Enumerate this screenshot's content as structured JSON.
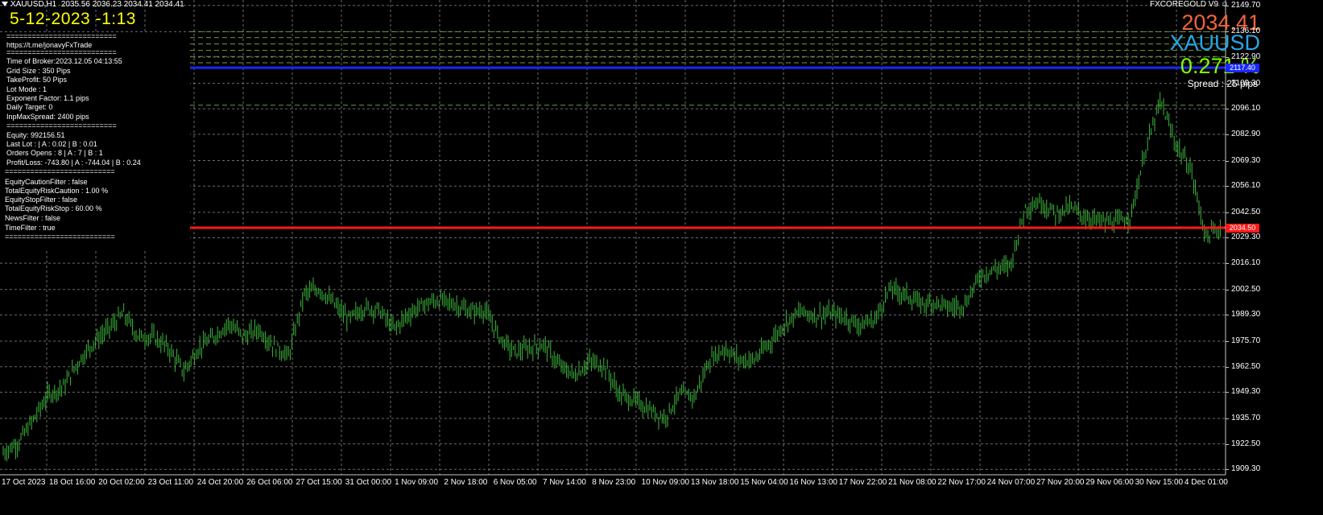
{
  "header": {
    "symbol_tf": "XAUUSD,H1",
    "ohlc": "2035.56 2036.23 2034.41 2034.41"
  },
  "broker_time": "5-12-2023 -1:13",
  "ea_name": "FXCOREGOLD V9 ☺",
  "overlay": {
    "price": "2034.41",
    "symbol": "XAUUSD",
    "percent": "0.271 %",
    "spread": "Spread : 25 pips"
  },
  "panel": {
    "lines": [
      "==========================",
      "https://t.me/jonavyFxTrade",
      "==========================",
      "Time of Broker:2023.12.05 04:13:55",
      "Grid Size : 350 Pips",
      "TakeProfit: 50 Pips",
      "Lot Mode : 1",
      "Exponent Factor: 1.1 pips",
      "Daily Target: 0",
      "InpMaxSpread: 2400 pips",
      "==========================",
      "Equity:     992156.51",
      "Last Lot : | A : 0.02 | B : 0.01",
      "Orders Opens :   8 | A : 7 | B : 1",
      "Profit/Loss: -743.80 | A : -744.04 | B : 0.24",
      "==========================",
      "EquityCautionFilter : false",
      "TotalEquityRiskCaution : 1.00 %",
      "EquityStopFilter : false",
      "TotalEquityRiskStop : 60.00 %",
      "NewsFilter : false",
      "TimeFilter : true",
      "=========================="
    ]
  },
  "price_tags": {
    "blue": "2117.40",
    "red": "2034.50"
  },
  "colors": {
    "bg": "#000000",
    "grid": "#6b6b6b",
    "bars": "#3db83d",
    "red_line": "#ff1a1a",
    "blue_line": "#1a28ff",
    "grid_levels": "#6a9e3c"
  },
  "chart_data": {
    "type": "line",
    "title": "XAUUSD,H1",
    "y_ticks": [
      "2149.70",
      "2136.10",
      "2122.90",
      "2109.30",
      "2096.10",
      "2082.90",
      "2069.30",
      "2056.10",
      "2042.50",
      "2029.30",
      "2016.10",
      "2002.50",
      "1989.30",
      "1975.70",
      "1962.50",
      "1949.30",
      "1935.70",
      "1922.50",
      "1909.30"
    ],
    "x_ticks": [
      "17 Oct 2023",
      "18 Oct 16:00",
      "20 Oct 02:00",
      "23 Oct 11:00",
      "24 Oct 20:00",
      "26 Oct 06:00",
      "27 Oct 15:00",
      "31 Oct 00:00",
      "1 Nov 09:00",
      "2 Nov 18:00",
      "6 Nov 05:00",
      "7 Nov 14:00",
      "8 Nov 23:00",
      "10 Nov 09:00",
      "13 Nov 18:00",
      "15 Nov 04:00",
      "16 Nov 13:00",
      "17 Nov 22:00",
      "21 Nov 08:00",
      "22 Nov 17:00",
      "24 Nov 07:00",
      "27 Nov 20:00",
      "29 Nov 06:00",
      "30 Nov 15:00",
      "4 Dec 01:00"
    ],
    "ylim": [
      1906.5,
      2152.5
    ],
    "price_path": [
      [
        0,
        1918
      ],
      [
        1,
        1923
      ],
      [
        2,
        1935
      ],
      [
        3,
        1948
      ],
      [
        4,
        1952
      ],
      [
        5,
        1965
      ],
      [
        6,
        1975
      ],
      [
        7,
        1982
      ],
      [
        8,
        1990
      ],
      [
        9,
        1978
      ],
      [
        10,
        1978
      ],
      [
        11,
        1972
      ],
      [
        12,
        1960
      ],
      [
        13,
        1972
      ],
      [
        14,
        1978
      ],
      [
        15,
        1985
      ],
      [
        16,
        1978
      ],
      [
        17,
        1982
      ],
      [
        18,
        1973
      ],
      [
        19,
        1968
      ],
      [
        20,
        2000
      ],
      [
        21,
        2003
      ],
      [
        22,
        1995
      ],
      [
        23,
        1987
      ],
      [
        24,
        1993
      ],
      [
        25,
        1992
      ],
      [
        26,
        1982
      ],
      [
        27,
        1990
      ],
      [
        28,
        1995
      ],
      [
        29,
        1997
      ],
      [
        30,
        1995
      ],
      [
        31,
        1991
      ],
      [
        32,
        1992
      ],
      [
        33,
        1978
      ],
      [
        34,
        1970
      ],
      [
        35,
        1972
      ],
      [
        36,
        1974
      ],
      [
        37,
        1963
      ],
      [
        38,
        1958
      ],
      [
        39,
        1965
      ],
      [
        40,
        1963
      ],
      [
        41,
        1948
      ],
      [
        42,
        1945
      ],
      [
        43,
        1940
      ],
      [
        44,
        1936
      ],
      [
        45,
        1948
      ],
      [
        46,
        1947
      ],
      [
        47,
        1966
      ],
      [
        48,
        1972
      ],
      [
        49,
        1966
      ],
      [
        50,
        1966
      ],
      [
        51,
        1975
      ],
      [
        52,
        1985
      ],
      [
        53,
        1991
      ],
      [
        54,
        1989
      ],
      [
        55,
        1990
      ],
      [
        56,
        1988
      ],
      [
        57,
        1984
      ],
      [
        58,
        1987
      ],
      [
        59,
        2003
      ],
      [
        60,
        2000
      ],
      [
        61,
        1995
      ],
      [
        62,
        1996
      ],
      [
        63,
        1993
      ],
      [
        64,
        1995
      ],
      [
        65,
        2010
      ],
      [
        66,
        2013
      ],
      [
        67,
        2015
      ],
      [
        68,
        2045
      ],
      [
        69,
        2048
      ],
      [
        70,
        2042
      ],
      [
        71,
        2045
      ],
      [
        72,
        2040
      ],
      [
        73,
        2038
      ],
      [
        74,
        2037
      ],
      [
        75,
        2040
      ],
      [
        76,
        2075
      ],
      [
        77,
        2100
      ],
      [
        78,
        2078
      ],
      [
        79,
        2065
      ],
      [
        80,
        2030
      ],
      [
        81,
        2034.4
      ]
    ],
    "grid_levels": [
      2136.1,
      2133.0,
      2129.7,
      2126.4,
      2123.2,
      2120.0,
      2098.0
    ],
    "horizontal_lines": [
      {
        "value": 2117.4,
        "color": "blue"
      },
      {
        "value": 2034.5,
        "color": "red"
      }
    ]
  }
}
